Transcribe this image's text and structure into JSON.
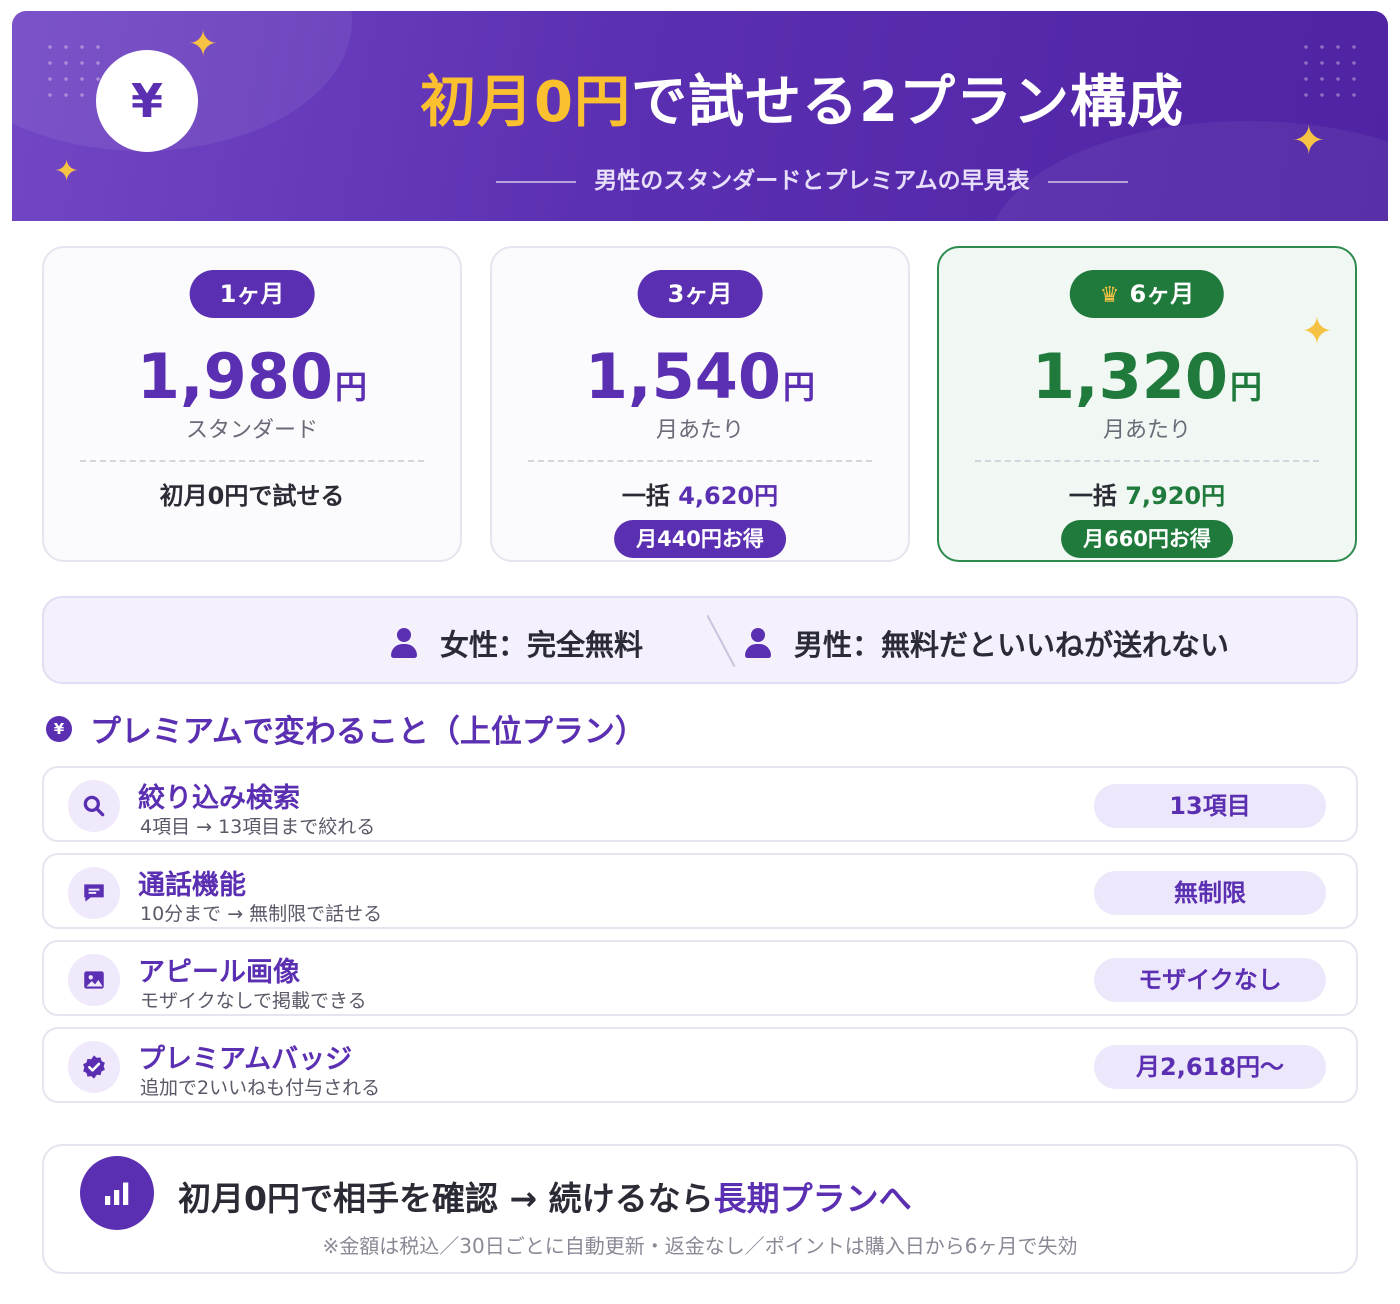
{
  "header": {
    "currency_symbol": "¥",
    "title_highlight": "初月0円",
    "title_rest": "で試せる2プラン構成",
    "subtitle": "男性のスタンダードとプレミアムの早見表"
  },
  "plans": [
    {
      "duration": "1ヶ月",
      "price": "1,980",
      "unit": "円",
      "sub": "スタンダード",
      "bulk_text": "初月0円で試せる",
      "bulk_value": "",
      "saving": ""
    },
    {
      "duration": "3ヶ月",
      "price": "1,540",
      "unit": "円",
      "sub": "月あたり",
      "bulk_text": "一括",
      "bulk_value": "4,620円",
      "saving": "月440円お得"
    },
    {
      "duration": "6ヶ月",
      "price": "1,320",
      "unit": "円",
      "sub": "月あたり",
      "bulk_text": "一括",
      "bulk_value": "7,920円",
      "saving": "月660円お得",
      "recommended": true
    }
  ],
  "gender": {
    "female": "女性：完全無料",
    "male": "男性：無料だといいねが送れない"
  },
  "premium_section": {
    "icon": "¥",
    "title": "プレミアムで変わること（上位プラン）",
    "features": [
      {
        "icon": "search-icon",
        "name": "絞り込み検索",
        "desc": "4項目 → 13項目まで絞れる",
        "tag": "13項目"
      },
      {
        "icon": "chat-icon",
        "name": "通話機能",
        "desc": "10分まで → 無制限で話せる",
        "tag": "無制限"
      },
      {
        "icon": "image-icon",
        "name": "アピール画像",
        "desc": "モザイクなしで掲載できる",
        "tag": "モザイクなし"
      },
      {
        "icon": "badge-check-icon",
        "name": "プレミアムバッジ",
        "desc": "追加で2いいねも付与される",
        "tag": "月2,618円〜"
      }
    ]
  },
  "footer": {
    "message_main": "初月0円で相手を確認 → 続けるなら",
    "message_highlight": "長期プランへ",
    "note": "※金額は税込／30日ごとに自動更新・返金なし／ポイントは購入日から6ヶ月で失効"
  },
  "colors": {
    "primary": "#5b2fb1",
    "accent_green": "#1f7a3c",
    "highlight_yellow": "#fbc02d"
  }
}
